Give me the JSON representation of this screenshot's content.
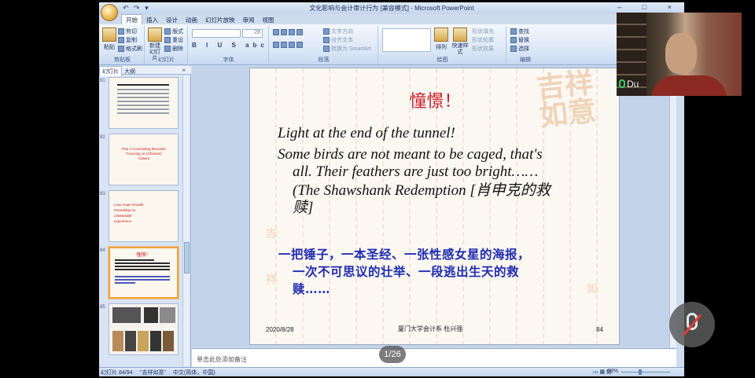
{
  "window": {
    "title": "文化影响与会计审计行为 [兼容模式] - Microsoft PowerPoint",
    "quick_access": "↶ ↷ ▾",
    "controls": "– □ ×"
  },
  "menu_tabs": [
    "开始",
    "插入",
    "设计",
    "动画",
    "幻灯片放映",
    "审阅",
    "视图"
  ],
  "ribbon": {
    "clipboard": {
      "group": "剪贴板",
      "paste": "粘贴",
      "cut": "剪切",
      "copy": "复制",
      "format_painter": "格式刷"
    },
    "slides": {
      "group": "幻灯片",
      "new_slide": "新建幻灯片",
      "layout": "版式",
      "reset": "重设",
      "delete": "删除"
    },
    "font": {
      "group": "字体",
      "size": "28",
      "format_buttons": "B I U S abc"
    },
    "paragraph": {
      "group": "段落",
      "text_direction": "文字方向",
      "align_text": "对齐文本",
      "smartart": "转换为 SmartArt"
    },
    "drawing": {
      "group": "绘图",
      "arrange": "排列",
      "quick_styles": "快速样式",
      "shape_fill": "形状填充",
      "shape_outline": "形状轮廓",
      "shape_effects": "形状效果"
    },
    "editing": {
      "group": "编辑",
      "find": "查找",
      "replace": "替换",
      "select": "选择"
    }
  },
  "left_panel": {
    "tabs": [
      "幻灯片",
      "大纲"
    ],
    "close": "×",
    "thumbnails": [
      {
        "num": "81"
      },
      {
        "num": "82",
        "text": "Part V  Concluding Remarks  Focusing on (Chinese) Culture"
      },
      {
        "num": "83",
        "text": "Love  Hope  Growth  Friendship  An unbearable experience"
      },
      {
        "num": "84",
        "title": "憧憬！",
        "selected": true
      },
      {
        "num": "85"
      }
    ]
  },
  "slide": {
    "title": "憧憬！",
    "lines": [
      "Light at the end of the tunnel!",
      "Some birds are not meant to be caged, that's",
      "all. Their feathers are just too bright……",
      "(The Shawshank Redemption [肖申克的救",
      "赎]"
    ],
    "chinese": [
      "一把锤子，一本圣经、一张性感女星的海报，",
      "一次不可思议的壮举、一段逃出生天的救",
      "赎……"
    ],
    "footer_date": "2020/8/28",
    "footer_center": "厦门大学会计系  杜兴强",
    "footer_page": "84",
    "decoration": "吉祥如意"
  },
  "notes_placeholder": "单击此处添加备注",
  "statusbar": {
    "slide_count": "幻灯片 84/94",
    "theme": "\"吉祥如意\"",
    "language": "中文(简体，中国)",
    "zoom": "68%"
  },
  "webcam": {
    "name": "Du"
  },
  "pager": "1/26",
  "colors": {
    "title_red": "#c8202a",
    "chinese_blue": "#1f2bb0",
    "ribbon_blue": "#cfdcee"
  }
}
